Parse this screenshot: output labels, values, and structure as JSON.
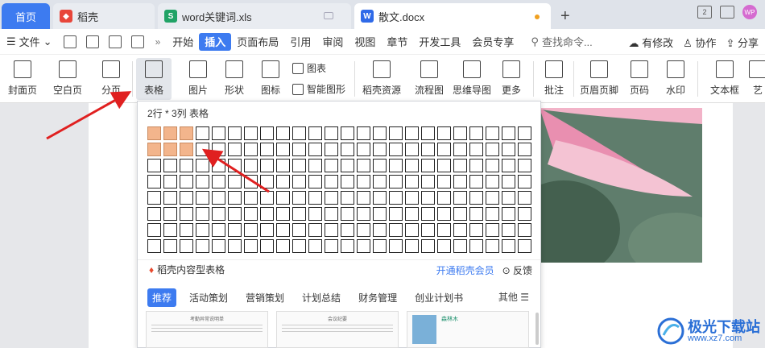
{
  "tabs": {
    "home": "首页",
    "docer": "稻壳",
    "xls": "word关键词.xls",
    "active": "散文.docx",
    "add": "+"
  },
  "titlebar": {
    "layout_toggle": "2",
    "avatar_text": "WP"
  },
  "menubar": {
    "file": "文件",
    "items": [
      "开始",
      "插入",
      "页面布局",
      "引用",
      "审阅",
      "视图",
      "章节",
      "开发工具",
      "会员专享"
    ],
    "search": "查找命令...",
    "modified": "有修改",
    "collab": "协作",
    "share": "分享"
  },
  "ribbon": {
    "cover": "封面页",
    "blank": "空白页",
    "pagebreak": "分页",
    "table": "表格",
    "picture": "图片",
    "shape": "形状",
    "icons": "图标",
    "chart": "图表",
    "smart": "智能图形",
    "docer_res": "稻壳资源",
    "flowchart": "流程图",
    "mindmap": "思维导图",
    "more": "更多",
    "comment": "批注",
    "header_footer": "页眉页脚",
    "page_num": "页码",
    "watermark": "水印",
    "textbox": "文本框",
    "art": "艺"
  },
  "popup": {
    "title": "2行 * 3列 表格",
    "grid": {
      "rows": 8,
      "cols": 24,
      "selected_rows": 2,
      "selected_cols": 3
    },
    "footer_left": "稻壳内容型表格",
    "vip": "开通稻壳会员",
    "feedback": "反馈",
    "categories": [
      "推荐",
      "活动策划",
      "营销策划",
      "计划总结",
      "财务管理",
      "创业计划书"
    ],
    "more": "其他",
    "thumb1_title": "考勤异常说明单",
    "thumb2_title": "会议纪要",
    "thumb3_name": "森林木"
  },
  "watermark": {
    "text": "极光下载站",
    "url": "www.xz7.com"
  },
  "colors": {
    "accent": "#3d7bf0",
    "highlight_cell": "#f3b58c",
    "arrow": "#e02020"
  }
}
